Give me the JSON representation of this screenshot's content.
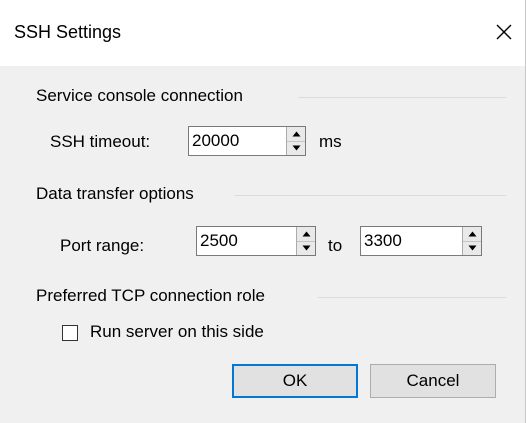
{
  "window": {
    "title": "SSH Settings",
    "close_glyph": "×"
  },
  "service_console": {
    "title": "Service console connection",
    "timeout_label": "SSH timeout:",
    "timeout_value": "20000",
    "timeout_unit": "ms"
  },
  "data_transfer": {
    "title": "Data transfer options",
    "port_range_label": "Port range:",
    "port_from": "2500",
    "to_label": "to",
    "port_to": "3300"
  },
  "tcp_role": {
    "title": "Preferred TCP connection role",
    "checkbox_label": "Run server on this side",
    "checked": false
  },
  "buttons": {
    "ok": "OK",
    "cancel": "Cancel"
  },
  "icons": {
    "close": "close-icon",
    "spin_up": "spin-up-icon",
    "spin_down": "spin-down-icon"
  },
  "colors": {
    "dialog_bg": "#f0f0f0",
    "titlebar_bg": "#ffffff",
    "default_button_border": "#0078d7",
    "button_bg": "#e1e1e1"
  }
}
